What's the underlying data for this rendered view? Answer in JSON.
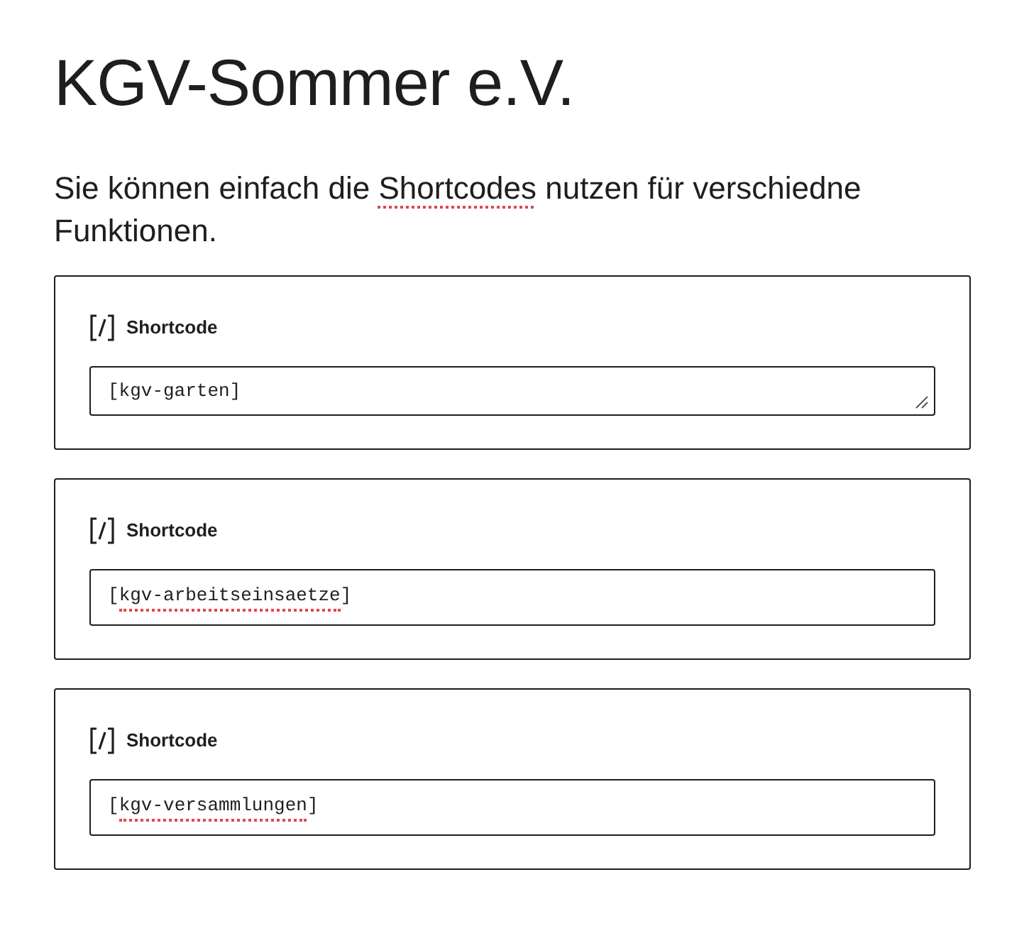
{
  "page": {
    "title": "KGV-Sommer e.V."
  },
  "intro": [
    {
      "text": "Sie können einfach die ",
      "misspelled": false
    },
    {
      "text": "Shortcodes",
      "misspelled": true
    },
    {
      "text": " nutzen für verschiedne Funktionen.",
      "misspelled": false
    }
  ],
  "blocks": [
    {
      "label": "Shortcode",
      "resizable": true,
      "value": [
        {
          "text": "[kgv-garten]",
          "misspelled": false
        }
      ]
    },
    {
      "label": "Shortcode",
      "resizable": false,
      "value": [
        {
          "text": "[",
          "misspelled": false
        },
        {
          "text": "kgv-arbeitseinsaetze",
          "misspelled": true
        },
        {
          "text": "]",
          "misspelled": false
        }
      ]
    },
    {
      "label": "Shortcode",
      "resizable": false,
      "value": [
        {
          "text": "[",
          "misspelled": false
        },
        {
          "text": "kgv-versammlungen",
          "misspelled": true
        },
        {
          "text": "]",
          "misspelled": false
        }
      ]
    }
  ]
}
